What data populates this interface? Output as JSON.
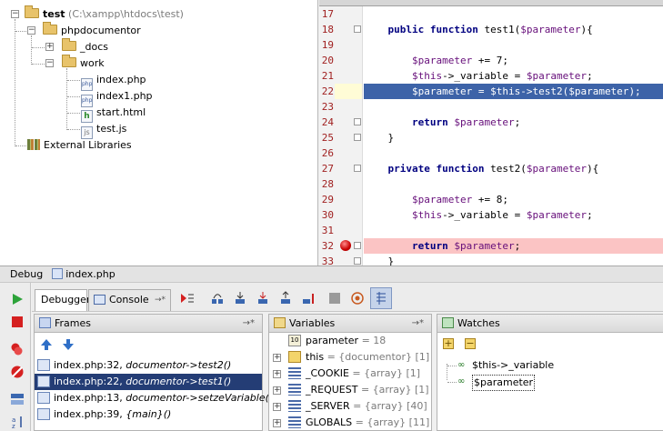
{
  "project_tree": {
    "root_label": "test",
    "root_path": "(C:\\xampp\\htdocs\\test)",
    "items": [
      {
        "label": "phpdocumentor",
        "type": "folder"
      },
      {
        "label": "_docs",
        "type": "folder"
      },
      {
        "label": "work",
        "type": "folder"
      },
      {
        "label": "index.php",
        "type": "php"
      },
      {
        "label": "index1.php",
        "type": "php"
      },
      {
        "label": "start.html",
        "type": "html"
      },
      {
        "label": "test.js",
        "type": "js"
      },
      {
        "label": "External Libraries",
        "type": "library"
      }
    ]
  },
  "editor": {
    "lines": [
      {
        "num": "17",
        "code": ""
      },
      {
        "num": "18",
        "code": "    public function test1($parameter){"
      },
      {
        "num": "19",
        "code": ""
      },
      {
        "num": "20",
        "code": "        $parameter += 7;"
      },
      {
        "num": "21",
        "code": "        $this->_variable = $parameter;"
      },
      {
        "num": "22",
        "code": "        $parameter = $this->test2($parameter);"
      },
      {
        "num": "23",
        "code": ""
      },
      {
        "num": "24",
        "code": "        return $parameter;"
      },
      {
        "num": "25",
        "code": "    }"
      },
      {
        "num": "26",
        "code": ""
      },
      {
        "num": "27",
        "code": "    private function test2($parameter){"
      },
      {
        "num": "28",
        "code": ""
      },
      {
        "num": "29",
        "code": "        $parameter += 8;"
      },
      {
        "num": "30",
        "code": "        $this->_variable = $parameter;"
      },
      {
        "num": "31",
        "code": ""
      },
      {
        "num": "32",
        "code": "        return $parameter;"
      },
      {
        "num": "33",
        "code": "    }"
      }
    ],
    "execution_line": "22",
    "breakpoint_line": "32"
  },
  "debug": {
    "title": "Debug",
    "session": "index.php",
    "tabs": {
      "debugger": "Debugger",
      "console": "Console"
    },
    "frames": {
      "header": "Frames",
      "items": [
        {
          "loc": "index.php:32,",
          "fn": "documentor->test2()"
        },
        {
          "loc": "index.php:22,",
          "fn": "documentor->test1()"
        },
        {
          "loc": "index.php:13,",
          "fn": "documentor->setzeVariable()"
        },
        {
          "loc": "index.php:39,",
          "fn": "{main}()"
        }
      ],
      "selected_index": 1
    },
    "variables": {
      "header": "Variables",
      "items": [
        {
          "name": "parameter",
          "value": "= 18",
          "type": ""
        },
        {
          "name": "this",
          "value": "= {documentor} [1]",
          "type": ""
        },
        {
          "name": "_COOKIE",
          "value": "= {array} [1]",
          "type": ""
        },
        {
          "name": "_REQUEST",
          "value": "= {array} [1]",
          "type": ""
        },
        {
          "name": "_SERVER",
          "value": "= {array} [40]",
          "type": ""
        },
        {
          "name": "GLOBALS",
          "value": "= {array} [11]",
          "type": ""
        }
      ]
    },
    "watches": {
      "header": "Watches",
      "items": [
        "$this->_variable",
        "$parameter"
      ]
    }
  }
}
